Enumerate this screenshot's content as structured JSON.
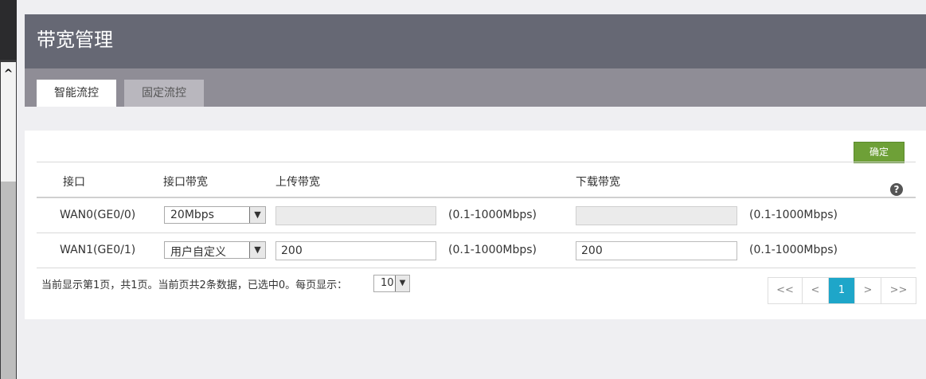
{
  "header": {
    "title": "带宽管理"
  },
  "tabs": [
    {
      "label": "智能流控",
      "active": true
    },
    {
      "label": "固定流控",
      "active": false
    }
  ],
  "toolbar": {
    "confirm_label": "确定"
  },
  "table": {
    "columns": [
      "接口",
      "接口带宽",
      "上传带宽",
      "下载带宽"
    ],
    "rows": [
      {
        "interface": "WAN0(GE0/0)",
        "bandwidth": "20Mbps",
        "upload": "",
        "upload_range": "(0.1-1000Mbps)",
        "download": "",
        "download_range": "(0.1-1000Mbps)",
        "editable": false
      },
      {
        "interface": "WAN1(GE0/1)",
        "bandwidth": "用户自定义",
        "upload": "200",
        "upload_range": "(0.1-1000Mbps)",
        "download": "200",
        "download_range": "(0.1-1000Mbps)",
        "editable": true
      }
    ]
  },
  "footer": {
    "summary": "当前显示第1页，共1页。当前页共2条数据，已选中0。每页显示：",
    "page_size": "10"
  },
  "pager": {
    "first": "<<",
    "prev": "<",
    "current": "1",
    "next": ">",
    "last": ">>"
  },
  "colors": {
    "header": "#666874",
    "tabbar": "#8f8d96",
    "confirm": "#6ea037",
    "pager_current": "#1ea6c9"
  }
}
